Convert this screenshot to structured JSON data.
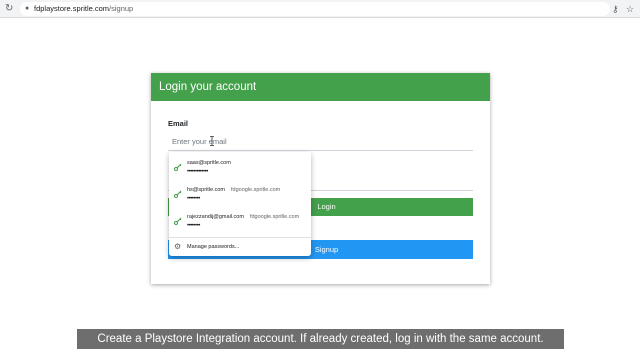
{
  "browser": {
    "url_domain": "fdplaystore.spritle.com",
    "url_path": "/signup",
    "reload_icon": "reload-icon",
    "lock_icon": "lock-icon",
    "key_icon": "key-icon",
    "star_icon": "star-icon"
  },
  "card": {
    "title": "Login your account",
    "email_label": "Email",
    "email_placeholder": "Enter your email",
    "login_label": "Login",
    "signup_label": "Signup"
  },
  "autofill": {
    "suggestions": [
      {
        "user": "saas@spritle.com",
        "site": "",
        "password": "•••••••••••••"
      },
      {
        "user": "hs@spritle.com",
        "site": "fdgoogle.spritle.com",
        "password": "••••••••"
      },
      {
        "user": "rajezzandij@gmail.com",
        "site": "fdgoogle.spritle.com",
        "password": "••••••••"
      }
    ],
    "manage_label": "Manage passwords..."
  },
  "caption": "Create a Playstore Integration account. If already created, log in with the same account.",
  "colors": {
    "header_green": "#43a04b",
    "login_green": "#43a04b",
    "signup_blue": "#2196f3"
  }
}
